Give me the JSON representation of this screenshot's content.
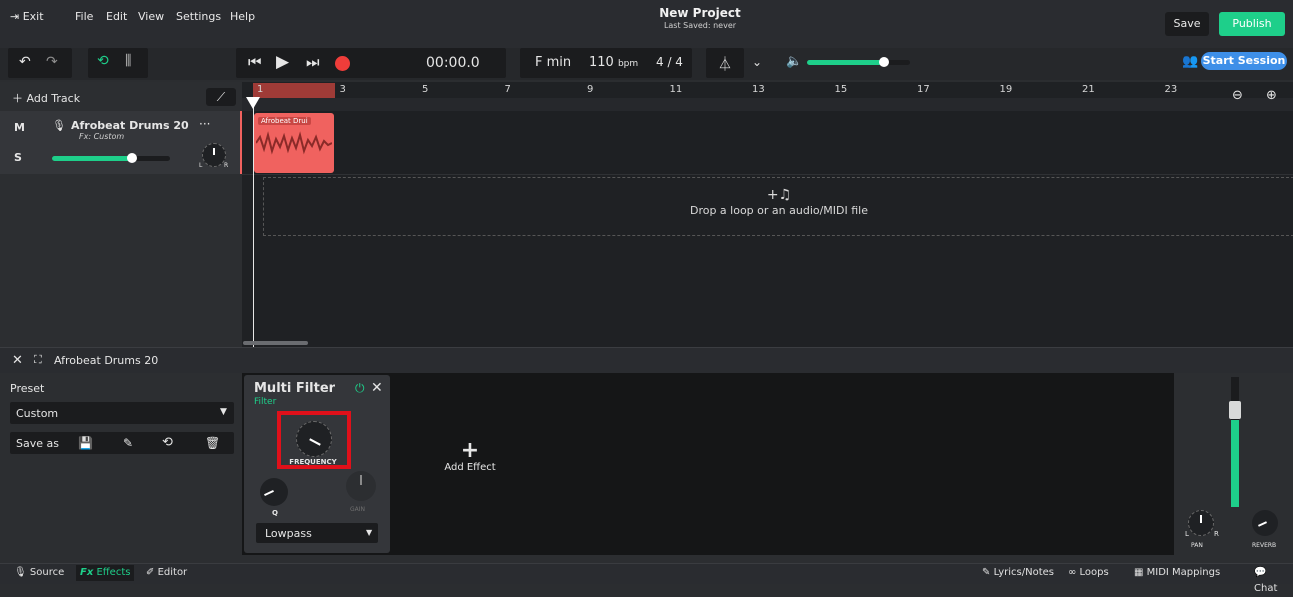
{
  "app": {
    "exit_label": "Exit",
    "menu": [
      "File",
      "Edit",
      "View",
      "Settings",
      "Help"
    ],
    "project_title": "New Project",
    "last_saved": "Last Saved: never",
    "save_label": "Save",
    "publish_label": "Publish",
    "start_session_label": "Start Session"
  },
  "transport": {
    "time": "00:00.0",
    "key": "F min",
    "bpm": "110",
    "bpm_unit": "bpm",
    "time_signature": "4 / 4",
    "volume": 0.75
  },
  "tracks_header": {
    "add_track_label": "Add Track"
  },
  "track": {
    "mute_label": "M",
    "solo_label": "S",
    "name": "Afrobeat Drums 20",
    "fx": "Fx: Custom",
    "volume": 0.68,
    "pan_l": "L",
    "pan_r": "R",
    "menu": "···"
  },
  "clip": {
    "label": "Afrobeat Drui"
  },
  "ruler": {
    "numbers": [
      "1",
      "3",
      "5",
      "7",
      "9",
      "11",
      "13",
      "15",
      "17",
      "19",
      "21",
      "23"
    ]
  },
  "dropzone": {
    "icon_label": "+♫",
    "text": "Drop a loop or an audio/MIDI file"
  },
  "panel": {
    "title": "Afrobeat Drums 20"
  },
  "preset": {
    "label": "Preset",
    "value": "Custom",
    "save_as_label": "Save as"
  },
  "effect": {
    "title": "Multi Filter",
    "subtitle": "Filter",
    "frequency_label": "FREQUENCY",
    "q_label": "Q",
    "gain_label": "GAIN",
    "type_value": "Lowpass",
    "add_effect_label": "Add Effect"
  },
  "mixer": {
    "pan_label": "PAN",
    "reverb_label": "REVERB",
    "pan_l": "L",
    "pan_r": "R"
  },
  "bottom_tabs": {
    "source": "Source",
    "effects": "Effects",
    "editor": "Editor",
    "lyrics": "Lyrics/Notes",
    "loops": "Loops",
    "midi": "MIDI Mappings",
    "chat": "Chat"
  },
  "colors": {
    "accent_green": "#1ecf8a",
    "clip_red": "#f0625f",
    "highlight_red": "#e0101a"
  }
}
